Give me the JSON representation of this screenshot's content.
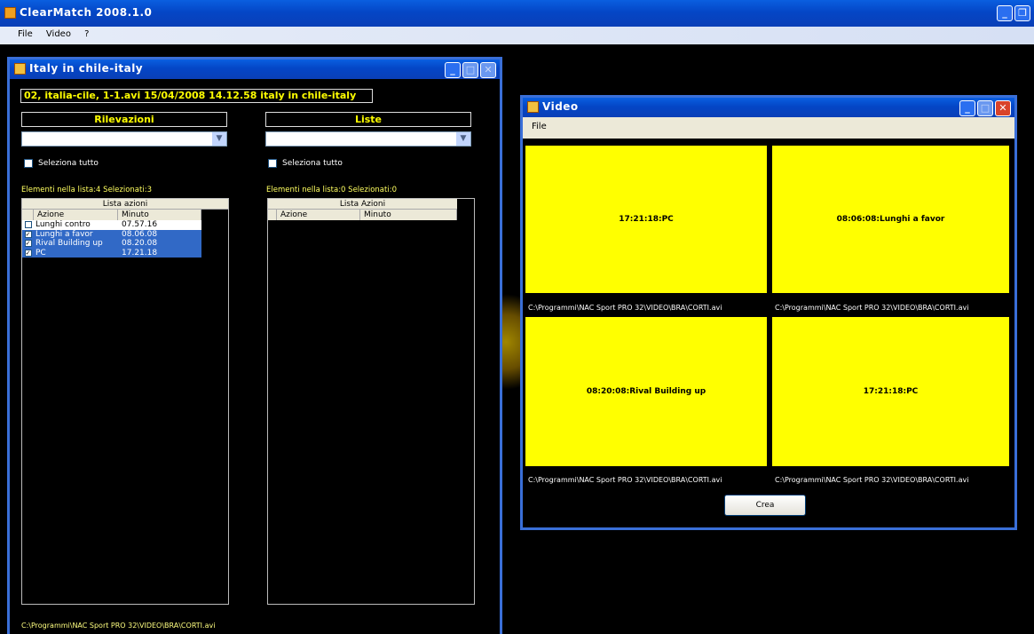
{
  "app": {
    "title": "ClearMatch 2008.1.0"
  },
  "menu": [
    "File",
    "Video",
    "?"
  ],
  "left_window": {
    "title": "Italy in chile-italy",
    "file_info": "02, italia-cile, 1-1.avi 15/04/2008 14.12.58 italy in chile-italy",
    "rilevazioni": {
      "header": "Rilevazioni",
      "select_all": "Seleziona tutto",
      "count": "Elementi nella lista:4 Selezionati:3",
      "list_caption": "Lista azioni",
      "col_action": "Azione",
      "col_minute": "Minuto",
      "rows": [
        {
          "action": "Lunghi contro",
          "minute": "07.57.16",
          "checked": false,
          "selected": false
        },
        {
          "action": "Lunghi a favor",
          "minute": "08.06.08",
          "checked": true,
          "selected": true
        },
        {
          "action": "Rival Building up",
          "minute": "08.20.08",
          "checked": true,
          "selected": true
        },
        {
          "action": "PC",
          "minute": "17.21.18",
          "checked": true,
          "selected": true
        }
      ]
    },
    "liste": {
      "header": "Liste",
      "select_all": "Seleziona tutto",
      "count": "Elementi nella lista:0 Selezionati:0",
      "list_caption": "Lista Azioni",
      "col_action": "Azione",
      "col_minute": "Minuto"
    },
    "bottom_path": "C:\\Programmi\\NAC Sport PRO 32\\VIDEO\\BRA\\CORTI.avi"
  },
  "video_window": {
    "title": "Video",
    "menu": [
      "File"
    ],
    "cells": [
      {
        "label": "17:21:18:PC",
        "path": "C:\\Programmi\\NAC Sport PRO 32\\VIDEO\\BRA\\CORTI.avi"
      },
      {
        "label": "08:06:08:Lunghi a favor",
        "path": "C:\\Programmi\\NAC Sport PRO 32\\VIDEO\\BRA\\CORTI.avi"
      },
      {
        "label": "08:20:08:Rival Building up",
        "path": "C:\\Programmi\\NAC Sport PRO 32\\VIDEO\\BRA\\CORTI.avi"
      },
      {
        "label": "17:21:18:PC",
        "path": "C:\\Programmi\\NAC Sport PRO 32\\VIDEO\\BRA\\CORTI.avi"
      }
    ],
    "button": "Crea"
  },
  "colors": {
    "accent": "#ffff00",
    "title_blue": "#0446c6",
    "selection": "#3169c6"
  }
}
